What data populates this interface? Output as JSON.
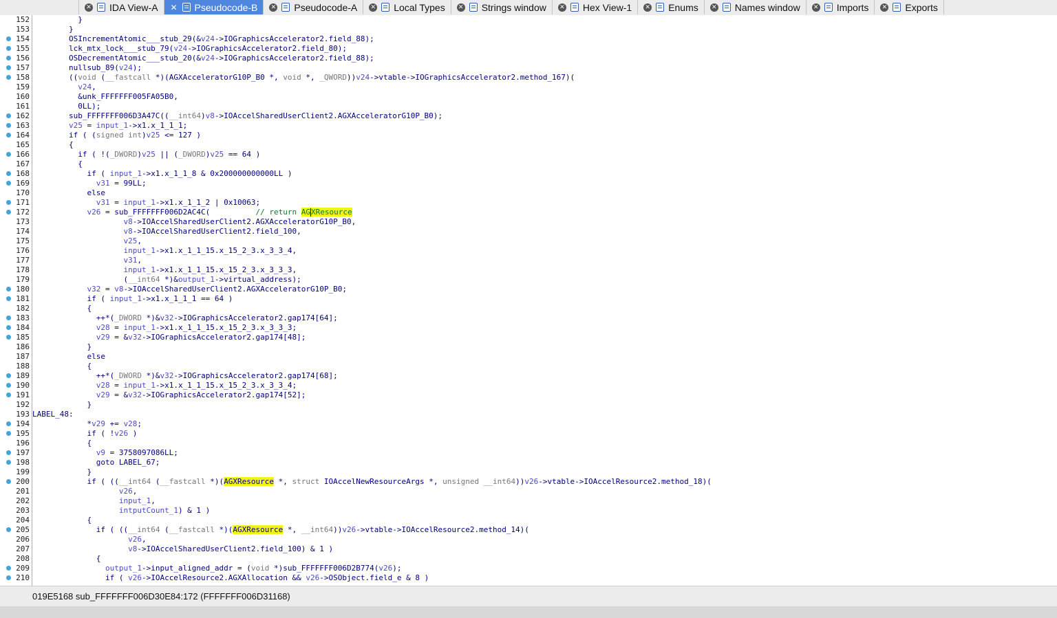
{
  "tabs": [
    {
      "label": "IDA View-A",
      "active": false,
      "icon": "view-icon"
    },
    {
      "label": "Pseudocode-B",
      "active": true,
      "icon": "pseudocode-icon"
    },
    {
      "label": "Pseudocode-A",
      "active": false,
      "icon": "pseudocode-icon"
    },
    {
      "label": "Local Types",
      "active": false,
      "icon": "types-icon"
    },
    {
      "label": "Strings window",
      "active": false,
      "icon": "strings-icon"
    },
    {
      "label": "Hex View-1",
      "active": false,
      "icon": "hex-icon"
    },
    {
      "label": "Enums",
      "active": false,
      "icon": "enums-icon"
    },
    {
      "label": "Names window",
      "active": false,
      "icon": "names-icon"
    },
    {
      "label": "Imports",
      "active": false,
      "icon": "imports-icon"
    },
    {
      "label": "Exports",
      "active": false,
      "icon": "exports-icon"
    }
  ],
  "code_lines": [
    {
      "n": "152",
      "dot": false,
      "text": "          }"
    },
    {
      "n": "153",
      "dot": false,
      "text": "        }"
    },
    {
      "n": "154",
      "dot": true,
      "text": "        OSIncrementAtomic___stub_29(&v24->IOGraphicsAccelerator2.field_88);"
    },
    {
      "n": "155",
      "dot": true,
      "text": "        lck_mtx_lock___stub_79(v24->IOGraphicsAccelerator2.field_80);"
    },
    {
      "n": "156",
      "dot": true,
      "text": "        OSDecrementAtomic___stub_20(&v24->IOGraphicsAccelerator2.field_88);"
    },
    {
      "n": "157",
      "dot": true,
      "text": "        nullsub_89(v24);"
    },
    {
      "n": "158",
      "dot": true,
      "text": "        ((void (__fastcall *)(AGXAcceleratorG10P_B0 *, void *, _QWORD))v24->vtable->IOGraphicsAccelerator2.method_167)("
    },
    {
      "n": "159",
      "dot": false,
      "text": "          v24,"
    },
    {
      "n": "160",
      "dot": false,
      "text": "          &unk_FFFFFFF005FA05B0,"
    },
    {
      "n": "161",
      "dot": false,
      "text": "          0LL);"
    },
    {
      "n": "162",
      "dot": true,
      "text": "        sub_FFFFFFF006D3A47C((__int64)v8->IOAccelSharedUserClient2.AGXAcceleratorG10P_B0);"
    },
    {
      "n": "163",
      "dot": true,
      "text": "        v25 = input_1->x1.x_1_1_1;"
    },
    {
      "n": "164",
      "dot": true,
      "text": "        if ( (signed int)v25 <= 127 )"
    },
    {
      "n": "165",
      "dot": false,
      "text": "        {"
    },
    {
      "n": "166",
      "dot": true,
      "text": "          if ( !(_DWORD)v25 || (_DWORD)v25 == 64 )"
    },
    {
      "n": "167",
      "dot": false,
      "text": "          {"
    },
    {
      "n": "168",
      "dot": true,
      "text": "            if ( input_1->x1.x_1_1_8 & 0x200000000000LL )"
    },
    {
      "n": "169",
      "dot": true,
      "text": "              v31 = 99LL;"
    },
    {
      "n": "170",
      "dot": false,
      "text": "            else"
    },
    {
      "n": "171",
      "dot": true,
      "text": "              v31 = input_1->x1.x_1_1_2 | 0x10063;"
    },
    {
      "n": "172",
      "dot": true,
      "text": "            v26 = sub_FFFFFFF006D2AC4C(          // return AGXResource"
    },
    {
      "n": "173",
      "dot": false,
      "text": "                    v8->IOAccelSharedUserClient2.AGXAcceleratorG10P_B0,"
    },
    {
      "n": "174",
      "dot": false,
      "text": "                    v8->IOAccelSharedUserClient2.field_100,"
    },
    {
      "n": "175",
      "dot": false,
      "text": "                    v25,"
    },
    {
      "n": "176",
      "dot": false,
      "text": "                    input_1->x1.x_1_1_15.x_15_2_3.x_3_3_4,"
    },
    {
      "n": "177",
      "dot": false,
      "text": "                    v31,"
    },
    {
      "n": "178",
      "dot": false,
      "text": "                    input_1->x1.x_1_1_15.x_15_2_3.x_3_3_3,"
    },
    {
      "n": "179",
      "dot": false,
      "text": "                    (__int64 *)&output_1->virtual_address);"
    },
    {
      "n": "180",
      "dot": true,
      "text": "            v32 = v8->IOAccelSharedUserClient2.AGXAcceleratorG10P_B0;"
    },
    {
      "n": "181",
      "dot": true,
      "text": "            if ( input_1->x1.x_1_1_1 == 64 )"
    },
    {
      "n": "182",
      "dot": false,
      "text": "            {"
    },
    {
      "n": "183",
      "dot": true,
      "text": "              ++*(_DWORD *)&v32->IOGraphicsAccelerator2.gap174[64];"
    },
    {
      "n": "184",
      "dot": true,
      "text": "              v28 = input_1->x1.x_1_1_15.x_15_2_3.x_3_3_3;"
    },
    {
      "n": "185",
      "dot": true,
      "text": "              v29 = &v32->IOGraphicsAccelerator2.gap174[48];"
    },
    {
      "n": "186",
      "dot": false,
      "text": "            }"
    },
    {
      "n": "187",
      "dot": false,
      "text": "            else"
    },
    {
      "n": "188",
      "dot": false,
      "text": "            {"
    },
    {
      "n": "189",
      "dot": true,
      "text": "              ++*(_DWORD *)&v32->IOGraphicsAccelerator2.gap174[68];"
    },
    {
      "n": "190",
      "dot": true,
      "text": "              v28 = input_1->x1.x_1_1_15.x_15_2_3.x_3_3_4;"
    },
    {
      "n": "191",
      "dot": true,
      "text": "              v29 = &v32->IOGraphicsAccelerator2.gap174[52];"
    },
    {
      "n": "192",
      "dot": false,
      "text": "            }"
    },
    {
      "n": "193",
      "dot": false,
      "text": "LABEL_48:"
    },
    {
      "n": "194",
      "dot": true,
      "text": "            *v29 += v28;"
    },
    {
      "n": "195",
      "dot": true,
      "text": "            if ( !v26 )"
    },
    {
      "n": "196",
      "dot": false,
      "text": "            {"
    },
    {
      "n": "197",
      "dot": true,
      "text": "              v9 = 3758097086LL;"
    },
    {
      "n": "198",
      "dot": true,
      "text": "              goto LABEL_67;"
    },
    {
      "n": "199",
      "dot": false,
      "text": "            }"
    },
    {
      "n": "200",
      "dot": true,
      "text": "            if ( ((__int64 (__fastcall *)(AGXResource *, struct IOAccelNewResourceArgs *, unsigned __int64))v26->vtable->IOAccelResource2.method_18)("
    },
    {
      "n": "201",
      "dot": false,
      "text": "                   v26,"
    },
    {
      "n": "202",
      "dot": false,
      "text": "                   input_1,"
    },
    {
      "n": "203",
      "dot": false,
      "text": "                   intputCount_1) & 1 )"
    },
    {
      "n": "204",
      "dot": false,
      "text": "            {"
    },
    {
      "n": "205",
      "dot": true,
      "text": "              if ( ((__int64 (__fastcall *)(AGXResource *, __int64))v26->vtable->IOAccelResource2.method_14)("
    },
    {
      "n": "206",
      "dot": false,
      "text": "                     v26,"
    },
    {
      "n": "207",
      "dot": false,
      "text": "                     v8->IOAccelSharedUserClient2.field_100) & 1 )"
    },
    {
      "n": "208",
      "dot": false,
      "text": "              {"
    },
    {
      "n": "209",
      "dot": true,
      "text": "                output_1->input_aligned_addr = (void *)sub_FFFFFFF006D2B774(v26);"
    },
    {
      "n": "210",
      "dot": true,
      "text": "                if ( v26->IOAccelResource2.AGXAllocation && v26->OSObject.field_e & 8 )"
    }
  ],
  "highlight_term": "AGXResource",
  "status": {
    "text": "019E5168  sub_FFFFFFF006D30E84:172 (FFFFFFF006D31168)"
  },
  "colors": {
    "keyword_text": "#000080",
    "variable_text": "#4a4ac8",
    "comment_text": "#0b7a2a",
    "highlight": "#f3f31a",
    "active_tab": "#4f86de",
    "breakpoint_dot": "#3fa6dc"
  }
}
